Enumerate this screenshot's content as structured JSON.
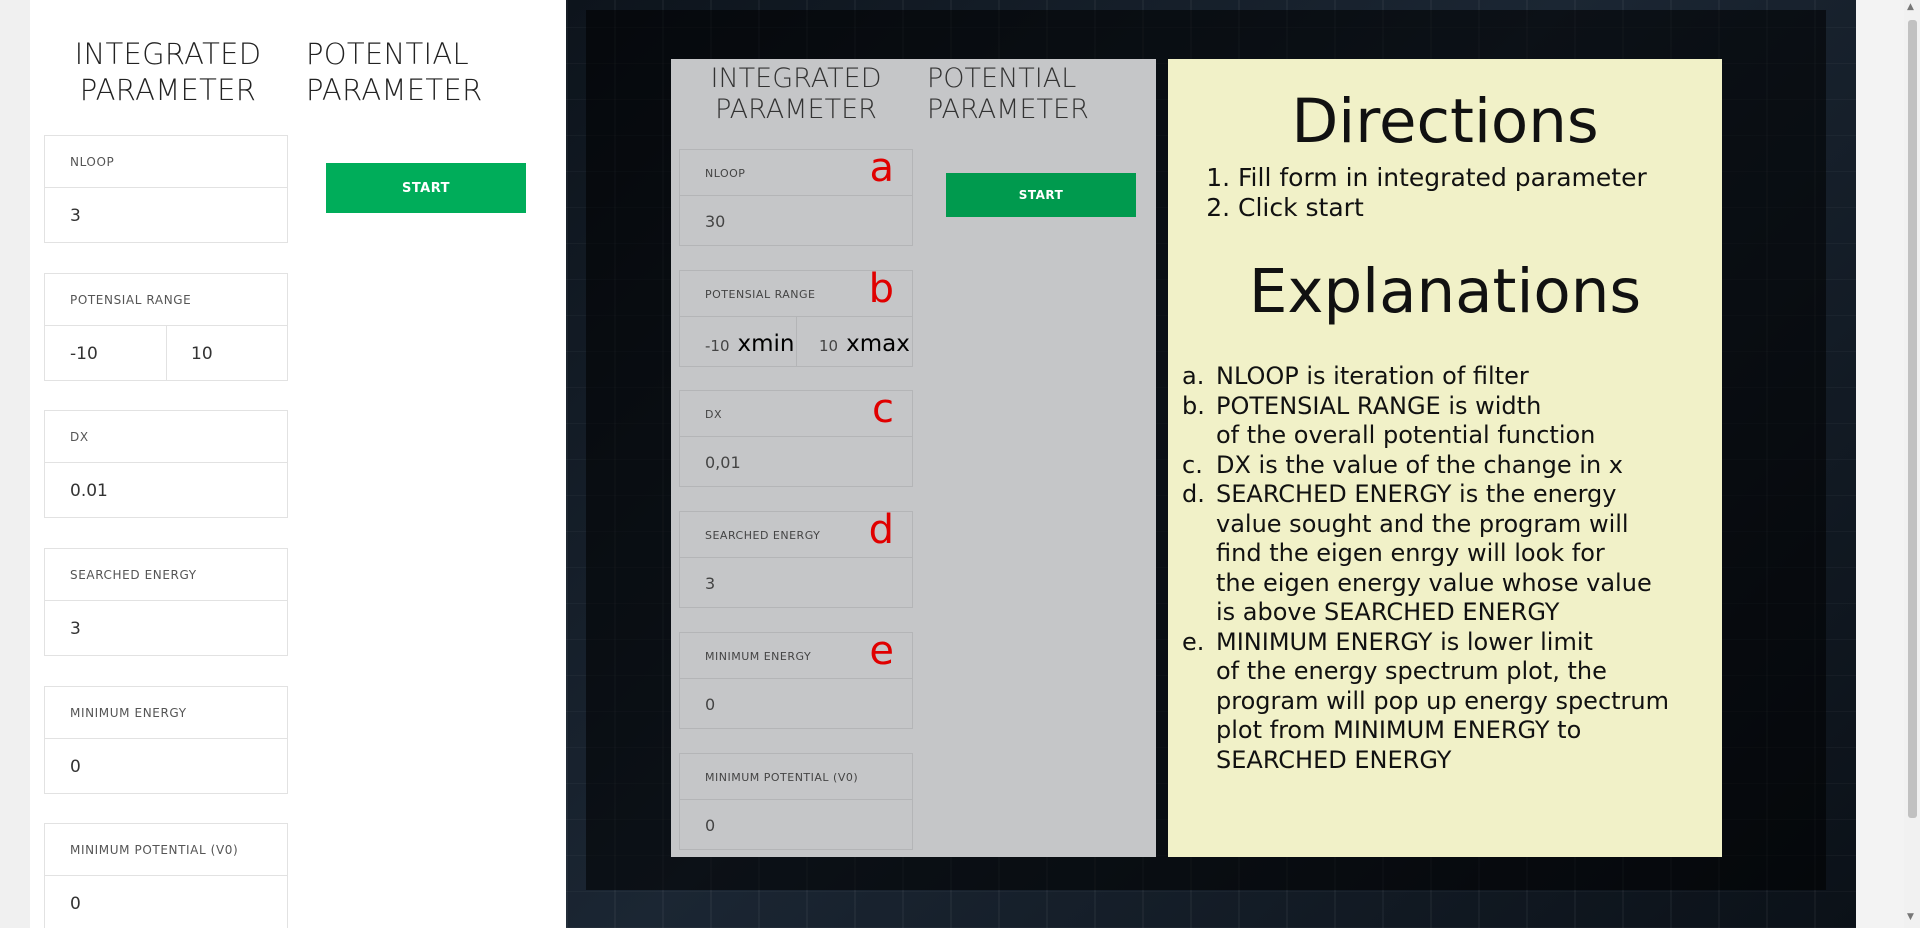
{
  "left_form": {
    "integrated_heading_line1": "INTEGRATED",
    "integrated_heading_line2": "PARAMETER",
    "potential_heading_line1": "POTENTIAL",
    "potential_heading_line2": "PARAMETER",
    "start_label": "START",
    "fields": [
      {
        "label": "NLOOP",
        "value": "3"
      },
      {
        "label": "POTENSIAL RANGE",
        "xmin": "-10",
        "xmax": "10"
      },
      {
        "label": "DX",
        "value": "0.01"
      },
      {
        "label": "SEARCHED ENERGY",
        "value": "3"
      },
      {
        "label": "MINIMUM ENERGY",
        "value": "0"
      },
      {
        "label": "MINIMUM POTENTIAL (V0)",
        "value": "0"
      }
    ]
  },
  "guide_image": {
    "integrated_heading_line1": "INTEGRATED",
    "integrated_heading_line2": "PARAMETER",
    "potential_heading_line1": "POTENTIAL",
    "potential_heading_line2": "PARAMETER",
    "start_label": "START",
    "fields": [
      {
        "label": "NLOOP",
        "value": "30",
        "marker": "a"
      },
      {
        "label": "POTENSIAL RANGE",
        "xmin": "-10",
        "xmin_note": "xmin",
        "xmax": "10",
        "xmax_note": "xmax",
        "marker": "b"
      },
      {
        "label": "DX",
        "value": "0,01",
        "marker": "c"
      },
      {
        "label": "SEARCHED ENERGY",
        "value": "3",
        "marker": "d"
      },
      {
        "label": "MINIMUM ENERGY",
        "value": "0",
        "marker": "e"
      },
      {
        "label": "MINIMUM POTENTIAL (V0)",
        "value": "0"
      }
    ],
    "directions_title": "Directions",
    "directions": [
      "Fill form in integrated parameter",
      "Click start"
    ],
    "explanations_title": "Explanations",
    "explanations": [
      {
        "marker": "a.",
        "lines": [
          "NLOOP is iteration of filter"
        ]
      },
      {
        "marker": "b.",
        "lines": [
          "POTENSIAL RANGE is width",
          "of the overall potential function"
        ]
      },
      {
        "marker": "c.",
        "lines": [
          "DX is the value of the change in x"
        ]
      },
      {
        "marker": "d.",
        "lines": [
          "SEARCHED ENERGY is the energy",
          "value sought and the program will",
          "find the eigen enrgy will look for",
          "the eigen energy value whose value",
          "is above SEARCHED ENERGY"
        ]
      },
      {
        "marker": "e.",
        "lines": [
          "MINIMUM ENERGY  is lower limit",
          "of the energy spectrum plot, the",
          "program will pop up energy spectrum",
          "plot from MINIMUM ENERGY to",
          "SEARCHED ENERGY"
        ]
      }
    ]
  },
  "colors": {
    "start_button": "#00ad5a",
    "marker_red": "#e00000",
    "info_box_bg": "#f1f1c8"
  }
}
